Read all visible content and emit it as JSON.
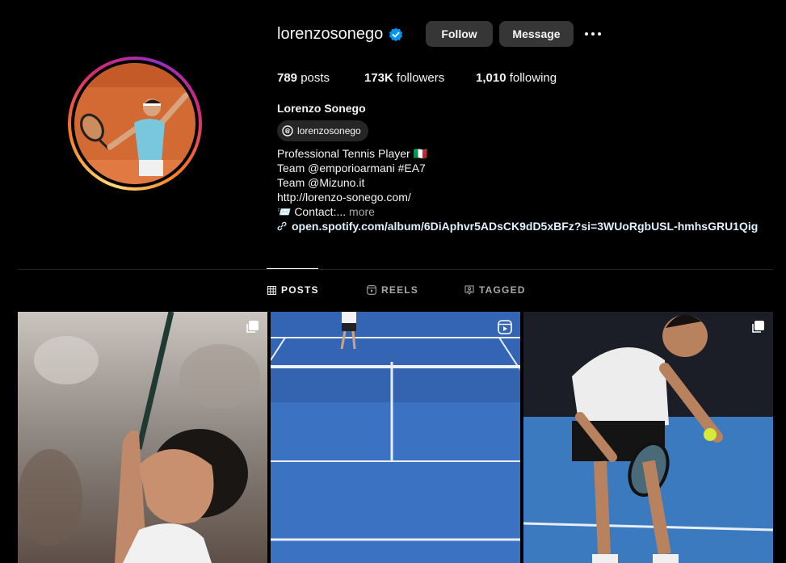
{
  "profile": {
    "username": "lorenzosonego",
    "verified": true,
    "full_name": "Lorenzo Sonego",
    "threads_handle": "lorenzosonego"
  },
  "actions": {
    "follow_label": "Follow",
    "message_label": "Message"
  },
  "stats": {
    "posts_count": "789",
    "posts_label": "posts",
    "followers_count": "173K",
    "followers_label": "followers",
    "following_count": "1,010",
    "following_label": "following"
  },
  "bio": {
    "line1": "Professional Tennis Player 🇮🇹",
    "line2": "Team @emporioarmani #EA7",
    "line3": "Team @Mizuno.it",
    "line4": "http://lorenzo-sonego.com/",
    "line5": "📨 Contact:...",
    "more_label": "more",
    "link": "open.spotify.com/album/6DiAphvr5ADsCK9dD5xBFz?si=3WUoRgbUSL-hmhsGRU1Qig"
  },
  "tabs": [
    {
      "label": "POSTS",
      "active": true
    },
    {
      "label": "REELS",
      "active": false
    },
    {
      "label": "TAGGED",
      "active": false
    }
  ],
  "posts": [
    {
      "badge": "carousel-icon"
    },
    {
      "badge": "reel-icon"
    },
    {
      "badge": "carousel-icon"
    }
  ],
  "colors": {
    "verified_blue": "#0095f6",
    "button_gray": "#363636",
    "background": "#000000",
    "court_clay": "#d9743a",
    "court_blue": "#3a6fc4"
  }
}
